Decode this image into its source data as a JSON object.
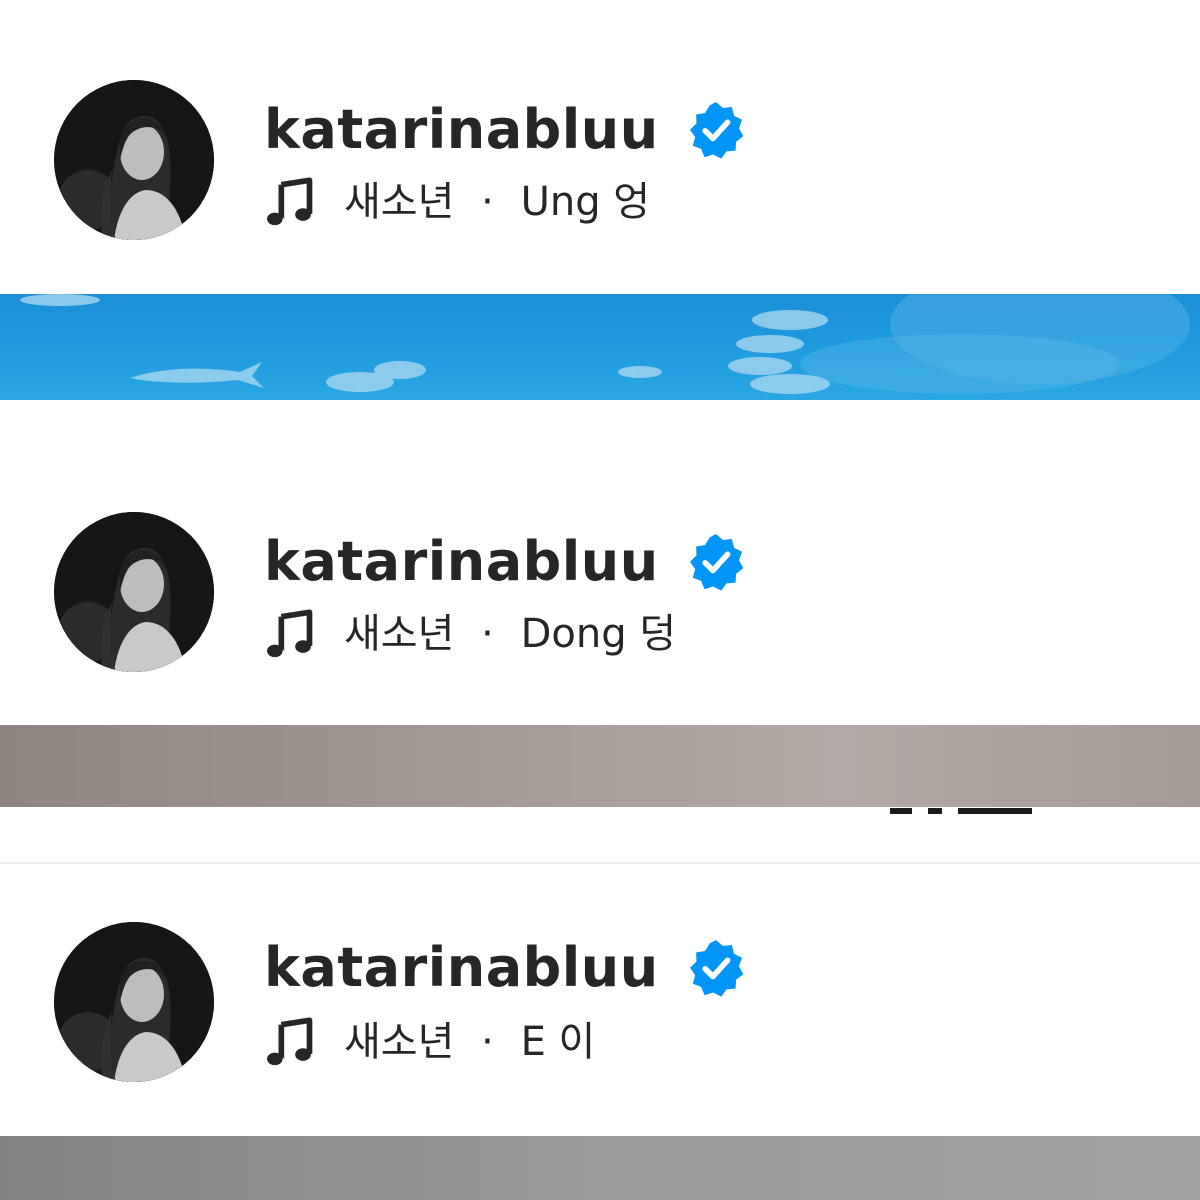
{
  "posts": [
    {
      "username": "katarinabluu",
      "verified": true,
      "artist": "새소년",
      "separator": "·",
      "track": "Ung 엉",
      "media_theme": "aquarium"
    },
    {
      "username": "katarinabluu",
      "verified": true,
      "artist": "새소년",
      "separator": "·",
      "track": "Dong 덩",
      "media_theme": "stone"
    },
    {
      "username": "katarinabluu",
      "verified": true,
      "artist": "새소년",
      "separator": "·",
      "track": "E 이",
      "media_theme": "grey"
    }
  ],
  "icons": {
    "verified": "verified-badge-icon",
    "audio": "music-note-icon"
  },
  "colors": {
    "text": "#262626",
    "verified_blue": "#0095f6",
    "aquarium_blue": "#1e99df",
    "stone": "#a69c98",
    "grey": "#9a9a9a"
  }
}
